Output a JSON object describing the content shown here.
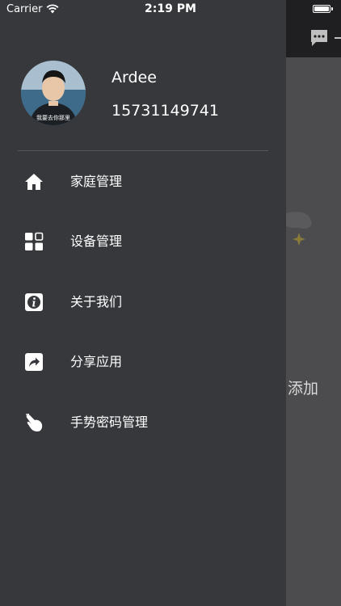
{
  "status_bar": {
    "carrier": "Carrier",
    "time": "2:19 PM"
  },
  "profile": {
    "name": "Ardee",
    "phone": "15731149741",
    "avatar_caption": "我要去你那里"
  },
  "menu": {
    "items": [
      {
        "label": "家庭管理",
        "icon": "home-icon"
      },
      {
        "label": "设备管理",
        "icon": "device-grid-icon"
      },
      {
        "label": "关于我们",
        "icon": "info-icon"
      },
      {
        "label": "分享应用",
        "icon": "share-icon"
      },
      {
        "label": "手势密码管理",
        "icon": "gesture-hand-icon"
      }
    ]
  },
  "background": {
    "add_label": "添加"
  },
  "colors": {
    "drawer": "#36383c",
    "overlay": "#4b4b4d",
    "navbar": "#1f1f21",
    "text": "#ffffff",
    "divider": "#56585c"
  }
}
